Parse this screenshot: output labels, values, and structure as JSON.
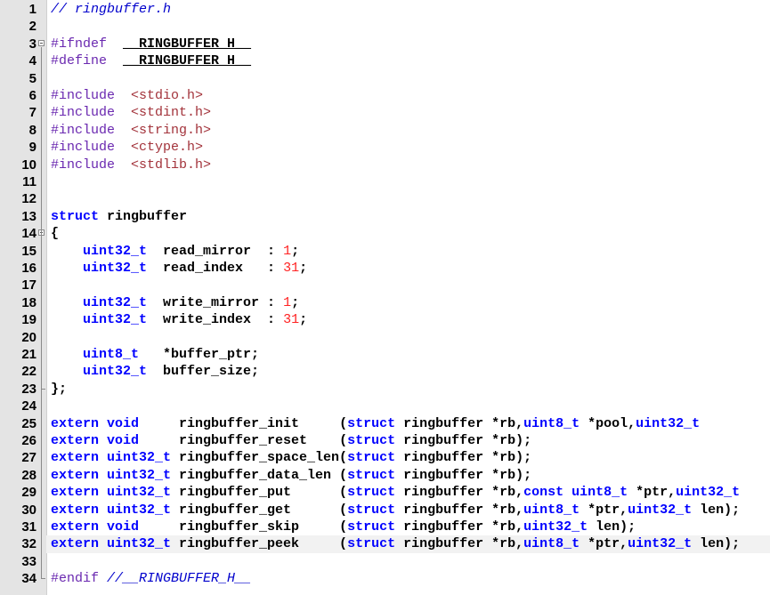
{
  "editor": {
    "file_name": "ringbuffer.h",
    "current_line": 32,
    "lines": [
      {
        "n": "1",
        "segs": [
          {
            "c": "cm",
            "t": "// ringbuffer.h"
          }
        ]
      },
      {
        "n": "2",
        "segs": []
      },
      {
        "n": "3",
        "segs": [
          {
            "c": "pp",
            "t": "#ifndef"
          },
          {
            "c": "op",
            "t": "  "
          },
          {
            "c": "guard",
            "t": "__RINGBUFFER_H__"
          }
        ],
        "fold": "open"
      },
      {
        "n": "4",
        "segs": [
          {
            "c": "pp",
            "t": "#define"
          },
          {
            "c": "op",
            "t": "  "
          },
          {
            "c": "guard",
            "t": "__RINGBUFFER_H__"
          }
        ]
      },
      {
        "n": "5",
        "segs": []
      },
      {
        "n": "6",
        "segs": [
          {
            "c": "pp",
            "t": "#include"
          },
          {
            "c": "op",
            "t": "  "
          },
          {
            "c": "inc",
            "t": "<stdio.h>"
          }
        ]
      },
      {
        "n": "7",
        "segs": [
          {
            "c": "pp",
            "t": "#include"
          },
          {
            "c": "op",
            "t": "  "
          },
          {
            "c": "inc",
            "t": "<stdint.h>"
          }
        ]
      },
      {
        "n": "8",
        "segs": [
          {
            "c": "pp",
            "t": "#include"
          },
          {
            "c": "op",
            "t": "  "
          },
          {
            "c": "inc",
            "t": "<string.h>"
          }
        ]
      },
      {
        "n": "9",
        "segs": [
          {
            "c": "pp",
            "t": "#include"
          },
          {
            "c": "op",
            "t": "  "
          },
          {
            "c": "inc",
            "t": "<ctype.h>"
          }
        ]
      },
      {
        "n": "10",
        "segs": [
          {
            "c": "pp",
            "t": "#include"
          },
          {
            "c": "op",
            "t": "  "
          },
          {
            "c": "inc",
            "t": "<stdlib.h>"
          }
        ]
      },
      {
        "n": "11",
        "segs": []
      },
      {
        "n": "12",
        "segs": []
      },
      {
        "n": "13",
        "segs": [
          {
            "c": "kw",
            "t": "struct"
          },
          {
            "c": "id",
            "t": " ringbuffer"
          }
        ]
      },
      {
        "n": "14",
        "segs": [
          {
            "c": "op",
            "t": "{"
          }
        ],
        "fold": "open"
      },
      {
        "n": "15",
        "segs": [
          {
            "c": "op",
            "t": "    "
          },
          {
            "c": "kw",
            "t": "uint32_t"
          },
          {
            "c": "id",
            "t": "  read_mirror  : "
          },
          {
            "c": "num",
            "t": "1"
          },
          {
            "c": "op",
            "t": ";"
          }
        ]
      },
      {
        "n": "16",
        "segs": [
          {
            "c": "op",
            "t": "    "
          },
          {
            "c": "kw",
            "t": "uint32_t"
          },
          {
            "c": "id",
            "t": "  read_index   : "
          },
          {
            "c": "num",
            "t": "31"
          },
          {
            "c": "op",
            "t": ";"
          }
        ]
      },
      {
        "n": "17",
        "segs": []
      },
      {
        "n": "18",
        "segs": [
          {
            "c": "op",
            "t": "    "
          },
          {
            "c": "kw",
            "t": "uint32_t"
          },
          {
            "c": "id",
            "t": "  write_mirror : "
          },
          {
            "c": "num",
            "t": "1"
          },
          {
            "c": "op",
            "t": ";"
          }
        ]
      },
      {
        "n": "19",
        "segs": [
          {
            "c": "op",
            "t": "    "
          },
          {
            "c": "kw",
            "t": "uint32_t"
          },
          {
            "c": "id",
            "t": "  write_index  : "
          },
          {
            "c": "num",
            "t": "31"
          },
          {
            "c": "op",
            "t": ";"
          }
        ]
      },
      {
        "n": "20",
        "segs": []
      },
      {
        "n": "21",
        "segs": [
          {
            "c": "op",
            "t": "    "
          },
          {
            "c": "kw",
            "t": "uint8_t"
          },
          {
            "c": "id",
            "t": "   *buffer_ptr;"
          }
        ]
      },
      {
        "n": "22",
        "segs": [
          {
            "c": "op",
            "t": "    "
          },
          {
            "c": "kw",
            "t": "uint32_t"
          },
          {
            "c": "id",
            "t": "  buffer_size;"
          }
        ]
      },
      {
        "n": "23",
        "segs": [
          {
            "c": "op",
            "t": "};"
          }
        ],
        "fold": "end"
      },
      {
        "n": "24",
        "segs": []
      },
      {
        "n": "25",
        "segs": [
          {
            "c": "kw",
            "t": "extern void"
          },
          {
            "c": "id",
            "t": "     ringbuffer_init     ("
          },
          {
            "c": "kw",
            "t": "struct"
          },
          {
            "c": "id",
            "t": " ringbuffer *rb,"
          },
          {
            "c": "kw",
            "t": "uint8_t"
          },
          {
            "c": "id",
            "t": " *pool,"
          },
          {
            "c": "kw",
            "t": "uint32_t"
          }
        ]
      },
      {
        "n": "26",
        "segs": [
          {
            "c": "kw",
            "t": "extern void"
          },
          {
            "c": "id",
            "t": "     ringbuffer_reset    ("
          },
          {
            "c": "kw",
            "t": "struct"
          },
          {
            "c": "id",
            "t": " ringbuffer *rb);"
          }
        ]
      },
      {
        "n": "27",
        "segs": [
          {
            "c": "kw",
            "t": "extern uint32_t"
          },
          {
            "c": "id",
            "t": " ringbuffer_space_len("
          },
          {
            "c": "kw",
            "t": "struct"
          },
          {
            "c": "id",
            "t": " ringbuffer *rb);"
          }
        ]
      },
      {
        "n": "28",
        "segs": [
          {
            "c": "kw",
            "t": "extern uint32_t"
          },
          {
            "c": "id",
            "t": " ringbuffer_data_len ("
          },
          {
            "c": "kw",
            "t": "struct"
          },
          {
            "c": "id",
            "t": " ringbuffer *rb);"
          }
        ]
      },
      {
        "n": "29",
        "segs": [
          {
            "c": "kw",
            "t": "extern uint32_t"
          },
          {
            "c": "id",
            "t": " ringbuffer_put      ("
          },
          {
            "c": "kw",
            "t": "struct"
          },
          {
            "c": "id",
            "t": " ringbuffer *rb,"
          },
          {
            "c": "kw",
            "t": "const uint8_t"
          },
          {
            "c": "id",
            "t": " *ptr,"
          },
          {
            "c": "kw",
            "t": "uint32_t"
          }
        ]
      },
      {
        "n": "30",
        "segs": [
          {
            "c": "kw",
            "t": "extern uint32_t"
          },
          {
            "c": "id",
            "t": " ringbuffer_get      ("
          },
          {
            "c": "kw",
            "t": "struct"
          },
          {
            "c": "id",
            "t": " ringbuffer *rb,"
          },
          {
            "c": "kw",
            "t": "uint8_t"
          },
          {
            "c": "id",
            "t": " *ptr,"
          },
          {
            "c": "kw",
            "t": "uint32_t"
          },
          {
            "c": "id",
            "t": " len);"
          }
        ]
      },
      {
        "n": "31",
        "segs": [
          {
            "c": "kw",
            "t": "extern void"
          },
          {
            "c": "id",
            "t": "     ringbuffer_skip     ("
          },
          {
            "c": "kw",
            "t": "struct"
          },
          {
            "c": "id",
            "t": " ringbuffer *rb,"
          },
          {
            "c": "kw",
            "t": "uint32_t"
          },
          {
            "c": "id",
            "t": " len);"
          }
        ]
      },
      {
        "n": "32",
        "segs": [
          {
            "c": "kw",
            "t": "extern uint32_t"
          },
          {
            "c": "id",
            "t": " ringbuffer_peek     ("
          },
          {
            "c": "kw",
            "t": "struct"
          },
          {
            "c": "id",
            "t": " ringbuffer *rb,"
          },
          {
            "c": "kw",
            "t": "uint8_t"
          },
          {
            "c": "id",
            "t": " *ptr,"
          },
          {
            "c": "kw",
            "t": "uint32_t"
          },
          {
            "c": "id",
            "t": " len);"
          }
        ]
      },
      {
        "n": "33",
        "segs": []
      },
      {
        "n": "34",
        "segs": [
          {
            "c": "pp",
            "t": "#endif"
          },
          {
            "c": "op",
            "t": " "
          },
          {
            "c": "cm",
            "t": "//__RINGBUFFER_H__"
          }
        ],
        "fold": "end"
      }
    ]
  },
  "colors": {
    "comment": "#0000cc",
    "preprocessor": "#6a28b0",
    "include_path": "#a3333b",
    "keyword": "#0000ff",
    "number": "#ff2222",
    "gutter_bg": "#e4e4e4",
    "current_line_bg": "#f2f2f2"
  }
}
